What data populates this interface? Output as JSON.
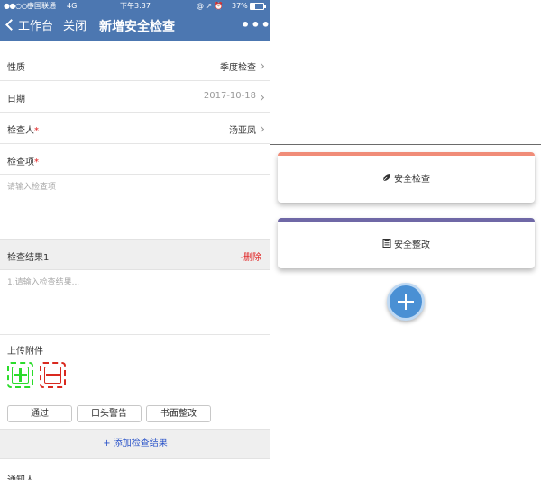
{
  "status_bar": {
    "signal": "●●○○○",
    "carrier": "中国联通",
    "network": "4G",
    "time": "下午3:37",
    "icons": "@ ↗ ⏰",
    "battery": "37%",
    "battery_level": 0.37
  },
  "nav": {
    "back_label": "工作台",
    "close_label": "关闭",
    "title": "新增安全检查",
    "more_label": "•••"
  },
  "form": {
    "nature": {
      "label": "性质",
      "value": "季度检查"
    },
    "date": {
      "label": "日期",
      "value": "2017-10-18"
    },
    "inspector": {
      "label": "检查人",
      "required_mark": "*",
      "value": "汤亚凤"
    },
    "items": {
      "label": "检查项",
      "required_mark": "*",
      "placeholder": "请输入检查项"
    },
    "result": {
      "title": "检查结果1",
      "delete_label": "-删除",
      "placeholder": "1.请输入检查结果..."
    },
    "upload": {
      "label": "上传附件"
    },
    "quick_buttons": [
      "通过",
      "口头警告",
      "书面整改"
    ],
    "add_result": "+ 添加检查结果",
    "notify_label": "通知人"
  },
  "right_panel": {
    "cards": [
      {
        "label": "安全检查",
        "icon": "leaf-icon",
        "accent": "#f08c78"
      },
      {
        "label": "安全整改",
        "icon": "list-icon",
        "accent": "#6f68a6"
      }
    ],
    "fab_icon": "plus-icon"
  },
  "colors": {
    "nav_bg": "#4c77b1",
    "required": "#e02020",
    "link_blue": "#2b54c9",
    "upload_add": "#2bdc2b",
    "upload_remove": "#d9291f",
    "fab": "#4a90d4"
  }
}
